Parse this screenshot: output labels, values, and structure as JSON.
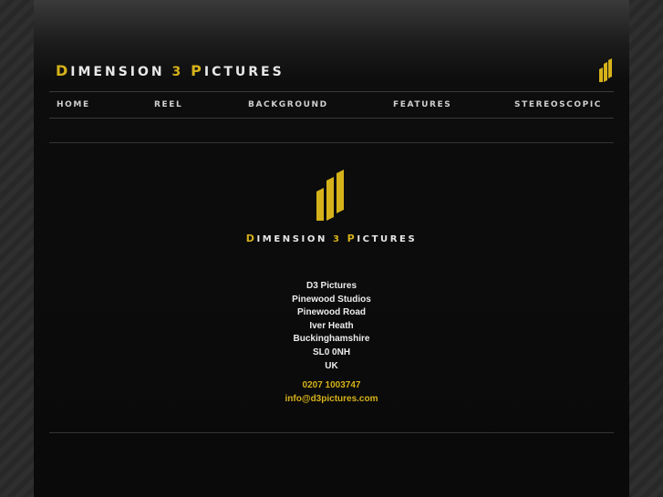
{
  "header": {
    "brand_d": "D",
    "brand_w1": "IMENSION ",
    "brand_num": "3",
    "brand_p": "P",
    "brand_w2": "ICTURES"
  },
  "nav": {
    "home": "HOME",
    "reel": "REEL",
    "background": "BACKGROUND",
    "features": "FEATURES",
    "stereoscopic": "STEREOSCOPIC"
  },
  "main": {
    "brand_d": "D",
    "brand_w1": "IMENSION ",
    "brand_num": "3",
    "brand_p": "P",
    "brand_w2": "ICTURES",
    "address": [
      "D3 Pictures",
      "Pinewood Studios",
      "Pinewood Road",
      "Iver Heath",
      "Buckinghamshire",
      "SL0 0NH",
      "UK"
    ],
    "phone": "0207 1003747",
    "email": "info@d3pictures.com"
  },
  "colors": {
    "accent": "#d6b21a",
    "background": "#0a0a0a"
  }
}
